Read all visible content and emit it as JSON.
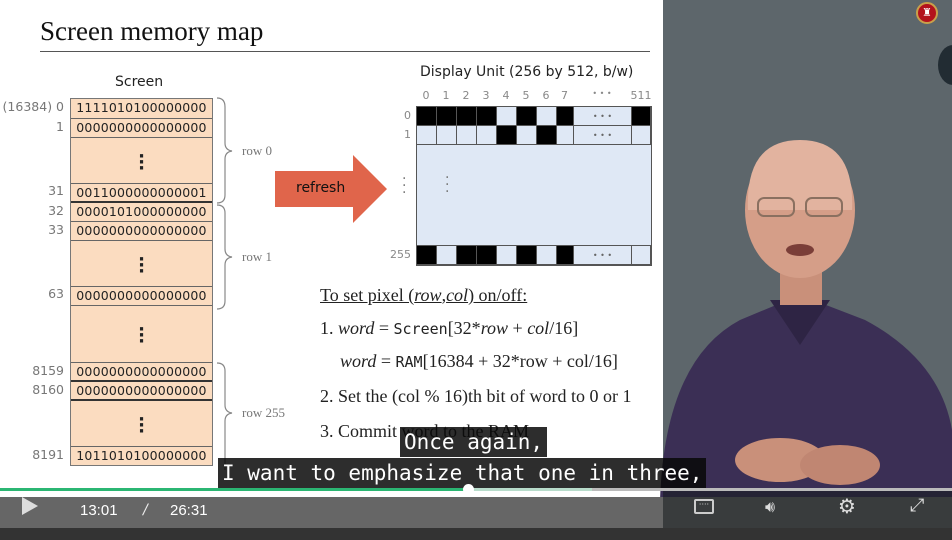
{
  "slide": {
    "title": "Screen memory map",
    "screen_label": "Screen",
    "memory": [
      {
        "addr": "(16384) 0",
        "value": "1111010100000000"
      },
      {
        "addr": "1",
        "value": "0000000000000000"
      },
      {
        "addr": "31",
        "value": "0011000000000001"
      },
      {
        "addr": "32",
        "value": "0000101000000000"
      },
      {
        "addr": "33",
        "value": "0000000000000000"
      },
      {
        "addr": "63",
        "value": "0000000000000000"
      },
      {
        "addr": "8159",
        "value": "0000000000000000"
      },
      {
        "addr": "8160",
        "value": "0000000000000000"
      },
      {
        "addr": "8191",
        "value": "1011010100000000"
      }
    ],
    "row_labels": [
      "row 0",
      "row 1",
      "row 255"
    ],
    "refresh_label": "refresh",
    "display_title": "Display Unit (256 by 512, b/w)",
    "col_labels": [
      "0",
      "1",
      "2",
      "3",
      "4",
      "5",
      "6",
      "7",
      "• • •",
      "511"
    ],
    "row_nums": [
      "0",
      "1",
      "255"
    ],
    "pixel_rows": {
      "row0": [
        1,
        1,
        1,
        1,
        0,
        1,
        0,
        1,
        1
      ],
      "row1": [
        0,
        0,
        0,
        0,
        1,
        0,
        1,
        0,
        0
      ],
      "row255": [
        1,
        0,
        1,
        1,
        0,
        1,
        0,
        1,
        0
      ]
    },
    "ellipsis": "• • •",
    "instructions": {
      "heading": "To set pixel (row,col) on/off:",
      "step1a_pre": "1. ",
      "step1a_word": "word",
      " eq": " = ",
      "step1a_fn": "Screen",
      "step1a_rest": "[32*row + col/16]",
      "step1b_fn": "RAM",
      "step1b_rest": "[16384 + 32*row + col/16]",
      "step2": "2. Set the (col % 16)th bit of word to 0 or 1",
      "step3": "3. Commit word to the RAM"
    }
  },
  "subtitles": [
    "Once again,",
    "I want to emphasize that one in three,"
  ],
  "player": {
    "current_time": "13:01",
    "separator": "/",
    "duration": "26:31",
    "progress_percent": 49.2,
    "buffered_percent": 62.2,
    "accent": "#2bb673"
  }
}
